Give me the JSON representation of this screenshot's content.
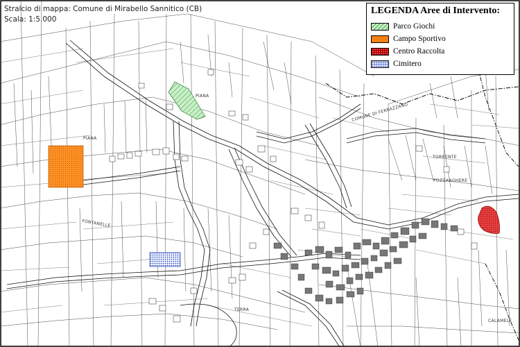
{
  "map": {
    "title": "Stralcio di mappa: Comune di Mirabello Sannitico (CB)",
    "scale": "Scala: 1:5.000"
  },
  "legend": {
    "title": "LEGENDA Aree di Intervento:",
    "items": [
      {
        "label": "Parco Giochi",
        "color": "#7fd77f",
        "pattern": "diagonal-hatch"
      },
      {
        "label": "Campo Sportivo",
        "color": "#ff8c1a",
        "pattern": "dotted-fill"
      },
      {
        "label": "Centro Raccolta",
        "color": "#e53030",
        "pattern": "cross-hatch"
      },
      {
        "label": "Cimitero",
        "color": "#1f3fbf",
        "pattern": "blue-dots"
      }
    ]
  },
  "place_labels": {
    "piana": "PIANA",
    "fontanelle": "FONTANELLE",
    "pozzanghere": "POZZANGHERE",
    "terra": "TERRA",
    "calamele": "CALAMELE",
    "comune_ferrazzano": "COMUNE DI FERRAZZANO",
    "torrente": "TORRENTE",
    "piana_top": "PIANA"
  }
}
